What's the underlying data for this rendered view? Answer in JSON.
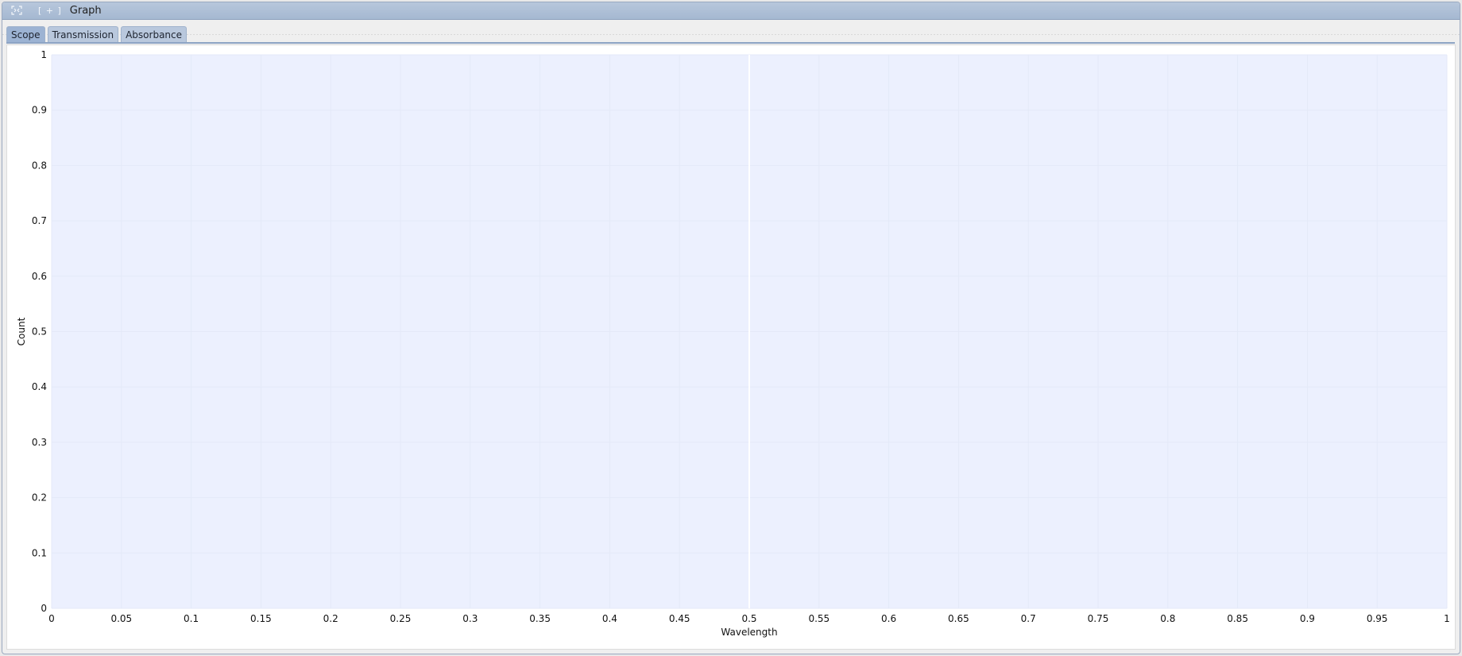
{
  "window": {
    "title": "Graph",
    "bracket_label": "[ + ]",
    "icons": {
      "expand": "expand-icon"
    }
  },
  "tabs": [
    {
      "label": "Scope",
      "active": true
    },
    {
      "label": "Transmission",
      "active": false
    },
    {
      "label": "Absorbance",
      "active": false
    }
  ],
  "colors": {
    "plot_background": "#ecf0fe",
    "title_bar": "#aebfd6",
    "active_tab": "#9cb3d3"
  },
  "chart_data": {
    "type": "line",
    "series": [],
    "xlabel": "Wavelength",
    "ylabel": "Count",
    "xlim": [
      0,
      1
    ],
    "ylim": [
      0,
      1
    ],
    "xticks": [
      "0",
      "0.05",
      "0.1",
      "0.15",
      "0.2",
      "0.25",
      "0.3",
      "0.35",
      "0.4",
      "0.45",
      "0.5",
      "0.55",
      "0.6",
      "0.65",
      "0.7",
      "0.75",
      "0.8",
      "0.85",
      "0.9",
      "0.95",
      "1"
    ],
    "yticks": [
      "0",
      "0.1",
      "0.2",
      "0.3",
      "0.4",
      "0.5",
      "0.6",
      "0.7",
      "0.8",
      "0.9",
      "1"
    ],
    "cursor_x": 0.5,
    "grid": true
  }
}
